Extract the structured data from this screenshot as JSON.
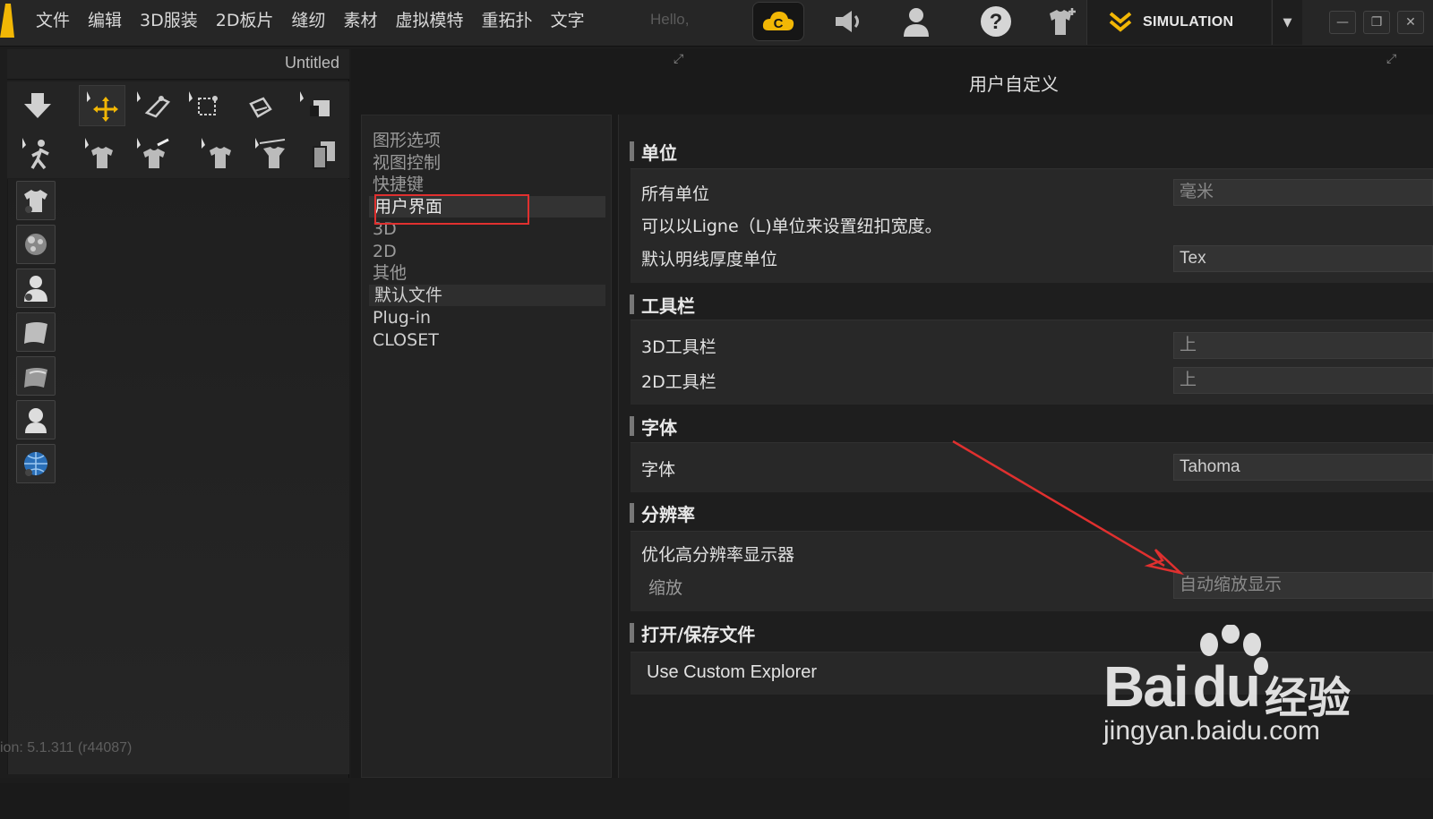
{
  "menubar": {
    "items": [
      "文件",
      "编辑",
      "3D服装",
      "2D板片",
      "缝纫",
      "素材",
      "虚拟模特",
      "重拓扑",
      "文字"
    ],
    "hello": "Hello,",
    "simulation_label": "SIMULATION"
  },
  "left_panel": {
    "title": "Untitled",
    "version": "ion: 5.1.311 (r44087)"
  },
  "dialog": {
    "title": "用户自定义",
    "categories": [
      "图形选项",
      "视图控制",
      "快捷键",
      "用户界面",
      "3D",
      "2D",
      "其他",
      "默认文件",
      "Plug-in",
      "CLOSET"
    ],
    "selected_category": "用户界面",
    "sections": {
      "units": {
        "title": "单位",
        "all_units_label": "所有单位",
        "all_units_value": "毫米",
        "note": "可以以Ligne（L)单位来设置纽扣宽度。",
        "thread_unit_label": "默认明线厚度单位",
        "thread_unit_value": "Tex"
      },
      "toolbar": {
        "title": "工具栏",
        "toolbar3d_label": "3D工具栏",
        "toolbar3d_value": "上",
        "toolbar2d_label": "2D工具栏",
        "toolbar2d_value": "上"
      },
      "font": {
        "title": "字体",
        "font_label": "字体",
        "font_value": "Tahoma"
      },
      "resolution": {
        "title": "分辨率",
        "optimize_label": "优化高分辨率显示器",
        "zoom_label": "缩放",
        "zoom_value": "自动缩放显示"
      },
      "file": {
        "title": "打开/保存文件",
        "custom_explorer_label": "Use Custom Explorer"
      }
    }
  },
  "watermark": {
    "brand": "Bai",
    "du": "du",
    "cn": "经验",
    "url": "jingyan.baidu.com"
  },
  "colors": {
    "accent_yellow": "#f2b705",
    "highlight_red": "#e0302f"
  }
}
